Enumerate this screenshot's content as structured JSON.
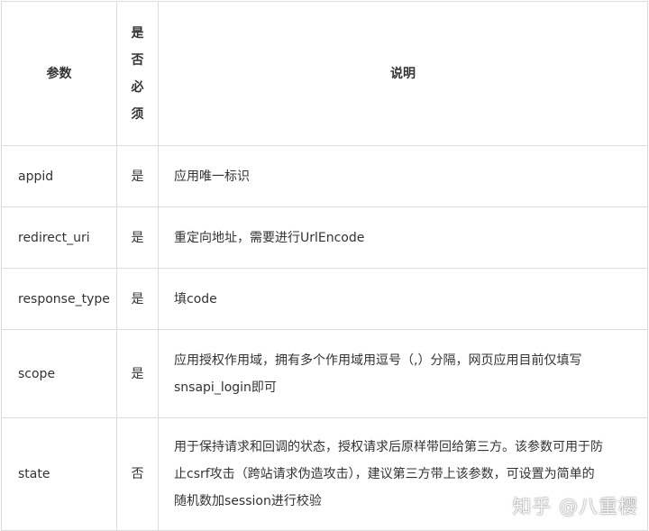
{
  "table": {
    "header": {
      "param": "参数",
      "required_chars": [
        "是",
        "否",
        "必",
        "须"
      ],
      "desc": "说明"
    },
    "rows": [
      {
        "param": "appid",
        "required": "是",
        "desc": "应用唯一标识"
      },
      {
        "param": "redirect_uri",
        "required": "是",
        "desc": "重定向地址，需要进行UrlEncode"
      },
      {
        "param": "response_type",
        "required": "是",
        "desc": "填code"
      },
      {
        "param": "scope",
        "required": "是",
        "desc_lines": [
          "应用授权作用域，拥有多个作用域用逗号（,）分隔，网页应用目前仅填写",
          "snsapi_login即可"
        ]
      },
      {
        "param": "state",
        "required": "否",
        "desc_lines": [
          "用于保持请求和回调的状态，授权请求后原样带回给第三方。该参数可用于防",
          "止csrf攻击（跨站请求伪造攻击），建议第三方带上该参数，可设置为简单的",
          "随机数加session进行校验"
        ]
      }
    ]
  },
  "watermark": "知乎 @八重樱"
}
